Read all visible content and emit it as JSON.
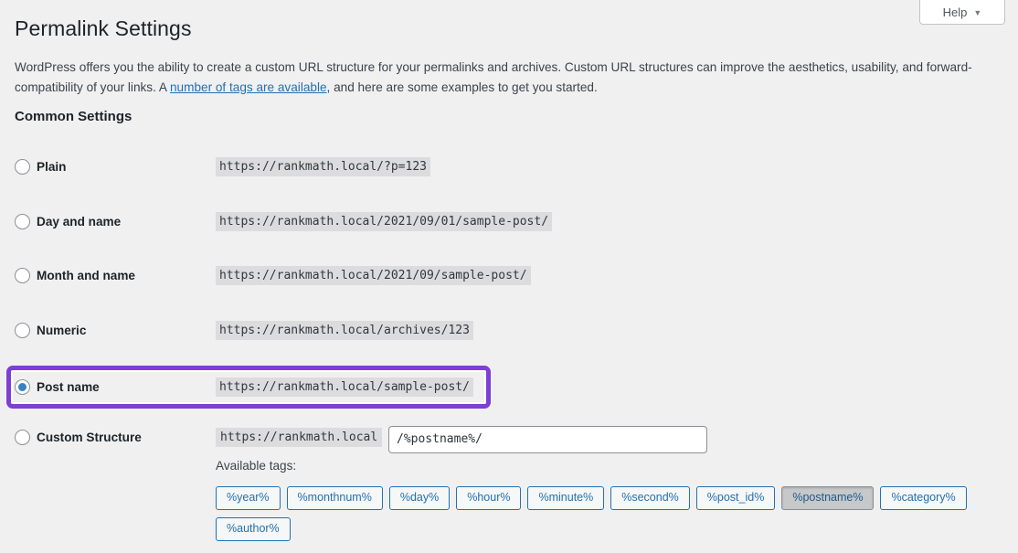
{
  "help": {
    "label": "Help",
    "caret_icon": "chevron-down-icon"
  },
  "page": {
    "title": "Permalink Settings",
    "intro_before_link": "WordPress offers you the ability to create a custom URL structure for your permalinks and archives. Custom URL structures can improve the aesthetics, usability, and forward-compatibility of your links. A ",
    "intro_link": "number of tags are available",
    "intro_after_link": ", and here are some examples to get you started.",
    "section_heading": "Common Settings"
  },
  "options": [
    {
      "id": "plain",
      "label": "Plain",
      "example": "https://rankmath.local/?p=123",
      "selected": false,
      "highlighted": false
    },
    {
      "id": "day-and-name",
      "label": "Day and name",
      "example": "https://rankmath.local/2021/09/01/sample-post/",
      "selected": false,
      "highlighted": false
    },
    {
      "id": "month-and-name",
      "label": "Month and name",
      "example": "https://rankmath.local/2021/09/sample-post/",
      "selected": false,
      "highlighted": false
    },
    {
      "id": "numeric",
      "label": "Numeric",
      "example": "https://rankmath.local/archives/123",
      "selected": false,
      "highlighted": false
    },
    {
      "id": "post-name",
      "label": "Post name",
      "example": "https://rankmath.local/sample-post/",
      "selected": true,
      "highlighted": true
    }
  ],
  "custom_structure": {
    "label": "Custom Structure",
    "selected": false,
    "prefix": "https://rankmath.local",
    "input_value": "/%postname%/",
    "available_tags_label": "Available tags:",
    "tags": [
      {
        "label": "%year%",
        "active": false
      },
      {
        "label": "%monthnum%",
        "active": false
      },
      {
        "label": "%day%",
        "active": false
      },
      {
        "label": "%hour%",
        "active": false
      },
      {
        "label": "%minute%",
        "active": false
      },
      {
        "label": "%second%",
        "active": false
      },
      {
        "label": "%post_id%",
        "active": false
      },
      {
        "label": "%postname%",
        "active": true
      },
      {
        "label": "%category%",
        "active": false
      },
      {
        "label": "%author%",
        "active": false
      }
    ]
  },
  "colors": {
    "page_background": "#f0f0f1",
    "link": "#2271b1",
    "highlight_border": "#7d3fd4",
    "radio_selected": "#3582c4",
    "code_background": "#dcdcde"
  }
}
